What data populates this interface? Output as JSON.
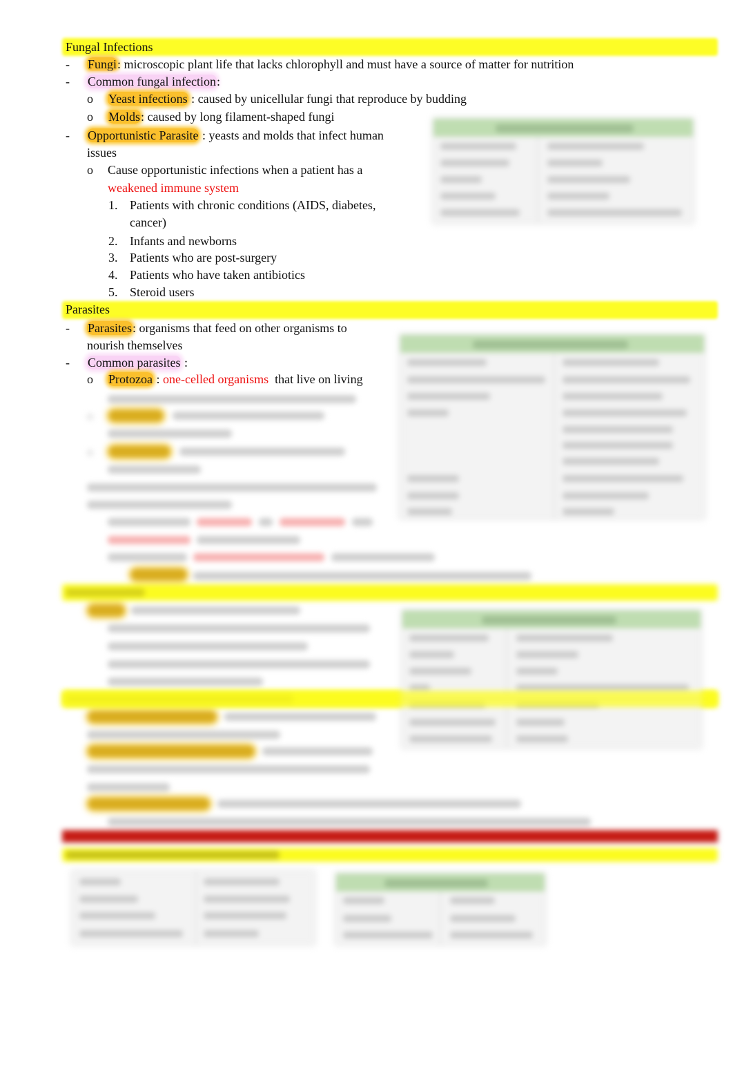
{
  "document": {
    "sections": {
      "fungal": {
        "heading": "Fungal Infections",
        "items": [
          {
            "marker": "-",
            "term": "Fungi",
            "text": ": microscopic plant life that lacks chlorophyll and must have a source of matter for nutrition"
          },
          {
            "marker": "-",
            "term": "Common fungal infection",
            "text": ":"
          },
          {
            "marker": "o",
            "term": "Yeast infections",
            "text": " : caused by unicellular fungi that reproduce by budding"
          },
          {
            "marker": "o",
            "term": "Molds",
            "text": ": caused by long filament-shaped fungi"
          },
          {
            "marker": "-",
            "term": "Opportunistic Parasite",
            "text": " : yeasts and molds that infect human",
            "continuation": "issues"
          },
          {
            "marker": "o",
            "text": "Cause opportunistic infections when a patient has a",
            "red_text": "weakened immune system"
          }
        ],
        "numbered": [
          {
            "num": "1.",
            "text": "Patients with chronic conditions (AIDS, diabetes,",
            "continuation": "cancer)"
          },
          {
            "num": "2.",
            "text": "Infants and newborns"
          },
          {
            "num": "3.",
            "text": "Patients who are post-surgery"
          },
          {
            "num": "4.",
            "text": "Patients who have taken antibiotics"
          },
          {
            "num": "5.",
            "text": "Steroid users"
          }
        ]
      },
      "parasites": {
        "heading": "Parasites",
        "items": [
          {
            "marker": "-",
            "term": "Parasites",
            "text": ": organisms that feed on other organisms to",
            "continuation": "nourish themselves"
          },
          {
            "marker": "-",
            "term": "Common parasites",
            "text": " :"
          },
          {
            "marker": "o",
            "term": "Protozoa",
            "text": " : ",
            "red_text": "one-celled organisms",
            "after": "  that live on living"
          }
        ]
      }
    },
    "colors": {
      "heading_highlight": "#fdfd26",
      "term_highlight": "#fbc02d",
      "pink_highlight": "#f9d3f5",
      "emphasis_red": "#ee1111",
      "table_header_green": "#bfddb1",
      "banner_red": "#c61b14"
    },
    "preview_state": "remaining content blurred"
  }
}
